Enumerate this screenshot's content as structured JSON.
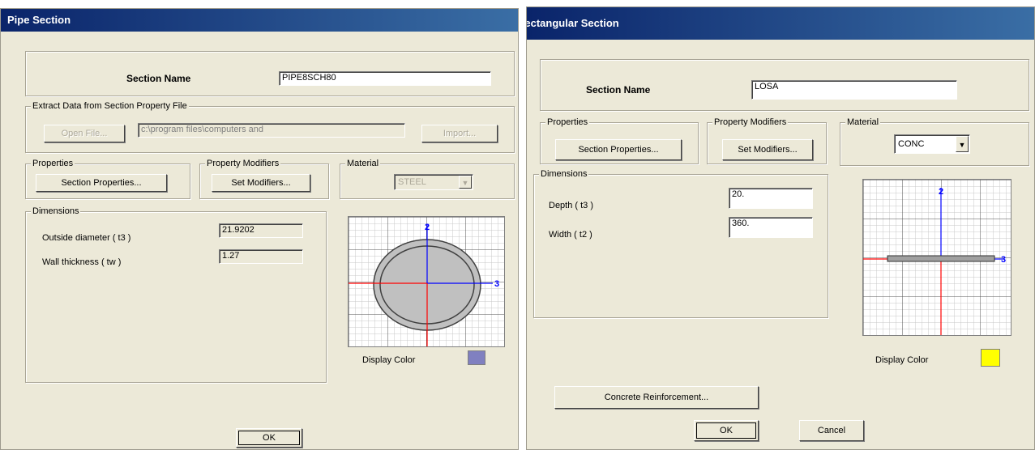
{
  "pipe_dialog": {
    "title": "Pipe Section",
    "section_name_label": "Section Name",
    "section_name_value": "PIPE8SCH80",
    "extract_group_label": "Extract Data from Section Property File",
    "open_file_label": "Open File...",
    "file_path_value": "c:\\program files\\computers and",
    "import_label": "Import...",
    "properties_group_label": "Properties",
    "section_properties_label": "Section Properties...",
    "modifiers_group_label": "Property Modifiers",
    "set_modifiers_label": "Set Modifiers...",
    "material_group_label": "Material",
    "material_value": "STEEL",
    "dimensions_group_label": "Dimensions",
    "outside_diameter_label": "Outside diameter  ( t3 )",
    "outside_diameter_value": "21.9202",
    "wall_thickness_label": "Wall thickness  ( tw )",
    "wall_thickness_value": "1.27",
    "display_color_label": "Display Color",
    "display_color": "#8080c0",
    "ok_label": "OK",
    "axis_2_label": "2",
    "axis_3_label": "3"
  },
  "rect_dialog": {
    "title": "Rectangular Section",
    "section_name_label": "Section Name",
    "section_name_value": "LOSA",
    "properties_group_label": "Properties",
    "section_properties_label": "Section Properties...",
    "modifiers_group_label": "Property Modifiers",
    "set_modifiers_label": "Set Modifiers...",
    "material_group_label": "Material",
    "material_value": "CONC",
    "dimensions_group_label": "Dimensions",
    "depth_label": "Depth  ( t3 )",
    "depth_value": "20.",
    "width_label": "Width  ( t2 )",
    "width_value": "360.",
    "display_color_label": "Display Color",
    "display_color": "#ffff00",
    "concrete_reinforcement_label": "Concrete Reinforcement...",
    "ok_label": "OK",
    "cancel_label": "Cancel",
    "axis_2_label": "2",
    "axis_3_label": "3"
  },
  "colors": {
    "title_bar_start": "#0a246a",
    "title_bar_end": "#3a6ea5",
    "dialog_face": "#ece9d8",
    "axis_vertical": "#0000ff",
    "axis_horizontal": "#ff0000"
  }
}
